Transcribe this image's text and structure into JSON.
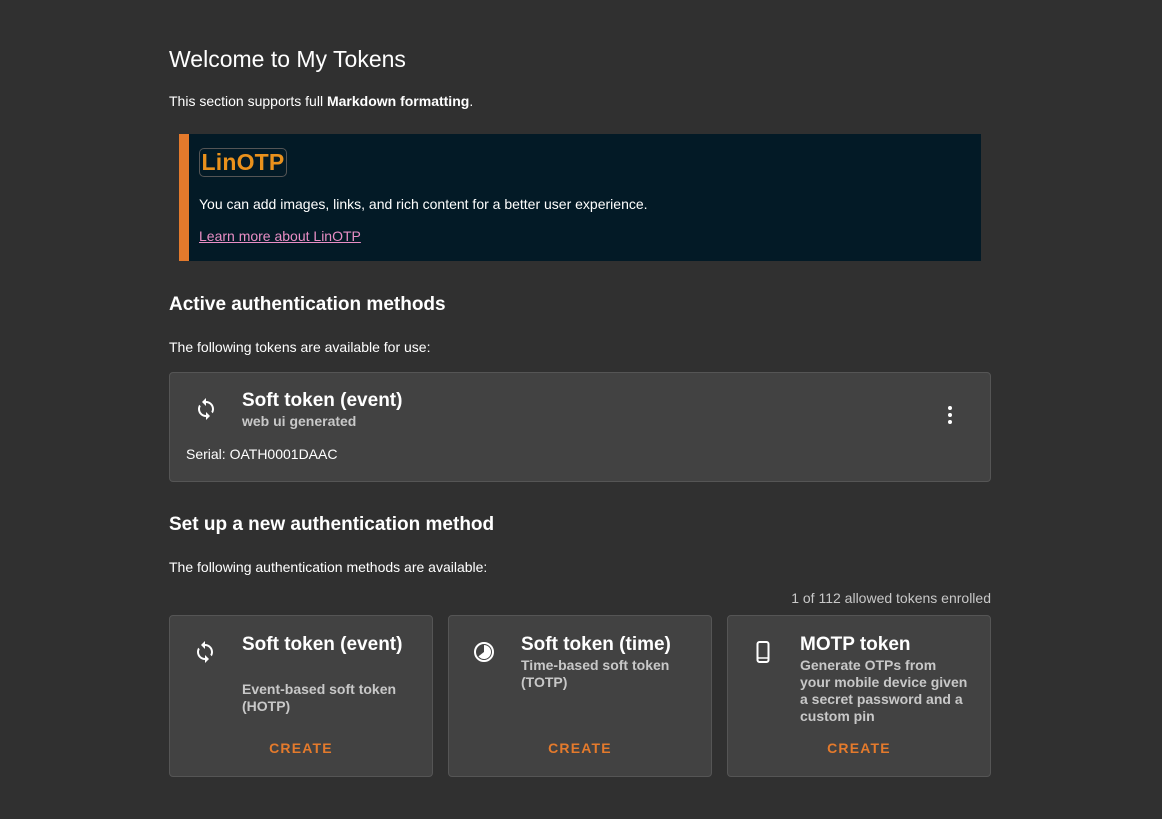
{
  "welcome": {
    "title": "Welcome to My Tokens",
    "intro_prefix": "This section supports full ",
    "intro_bold": "Markdown formatting",
    "intro_suffix": "."
  },
  "banner": {
    "logo_text": "LinOTP",
    "text": "You can add images, links, and rich content for a better user experience.",
    "link_text": "Learn more about LinOTP",
    "accent_color": "#e47a2c",
    "background_color": "#031a26",
    "link_color": "#e98ec5"
  },
  "active": {
    "title": "Active authentication methods",
    "subtitle": "The following tokens are available for use:",
    "tokens": [
      {
        "icon": "sync-icon",
        "name": "Soft token (event)",
        "description": "web ui generated",
        "serial": "Serial: OATH0001DAAC"
      }
    ]
  },
  "setup": {
    "title": "Set up a new authentication method",
    "subtitle": "The following authentication methods are available:",
    "enrolled_count": "1 of 112 allowed tokens enrolled",
    "methods": [
      {
        "icon": "sync-icon",
        "title": "Soft token (event)",
        "description": "Event-based soft token (HOTP)",
        "button": "CREATE"
      },
      {
        "icon": "clock-icon",
        "title": "Soft token (time)",
        "description": "Time-based soft token (TOTP)",
        "button": "CREATE"
      },
      {
        "icon": "mobile-phone-icon",
        "title": "MOTP token",
        "description": "Generate OTPs from your mobile device given a secret password and a custom pin",
        "button": "CREATE"
      }
    ]
  },
  "colors": {
    "background": "#303030",
    "card": "#424242",
    "accent": "#e47a2c"
  }
}
